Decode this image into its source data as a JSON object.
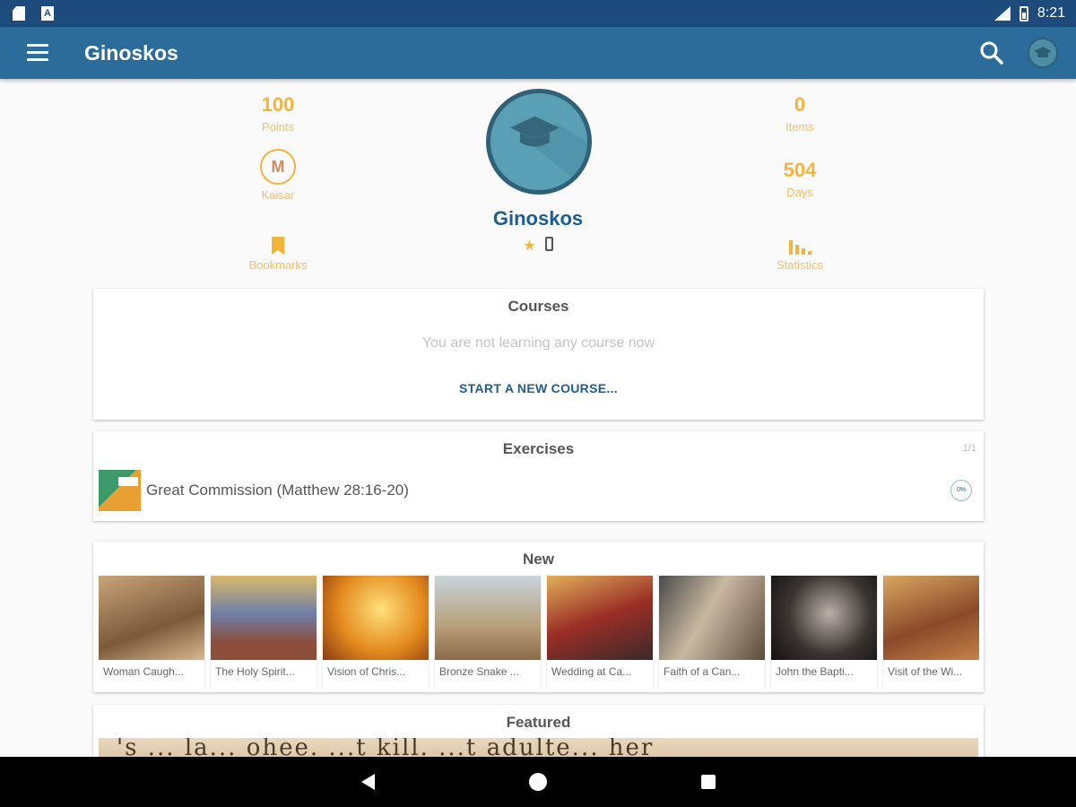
{
  "status_bar": {
    "time": "8:21"
  },
  "app_bar": {
    "title": "Ginoskos"
  },
  "profile": {
    "name": "Ginoskos",
    "points": {
      "value": "100",
      "label": "Points"
    },
    "items": {
      "value": "0",
      "label": "Items"
    },
    "days": {
      "value": "504",
      "label": "Days"
    },
    "level": {
      "label": "Kaisar"
    },
    "bookmarks": {
      "label": "Bookmarks"
    },
    "statistics": {
      "label": "Statistics"
    }
  },
  "courses": {
    "title": "Courses",
    "empty_text": "You are not learning any course now",
    "start_label": "START A NEW COURSE..."
  },
  "exercises": {
    "title": "Exercises",
    "page": "1/1",
    "items": [
      {
        "title": "Great Commission (Matthew 28:16-20)",
        "progress": "0%"
      }
    ]
  },
  "new_section": {
    "title": "New",
    "items": [
      {
        "caption": "Woman Caugh..."
      },
      {
        "caption": "The Holy Spirit..."
      },
      {
        "caption": "Vision of Chris..."
      },
      {
        "caption": "Bronze Snake ..."
      },
      {
        "caption": "Wedding at Ca..."
      },
      {
        "caption": "Faith of a Can..."
      },
      {
        "caption": "John the Bapti..."
      },
      {
        "caption": "Visit of the Wi..."
      }
    ]
  },
  "featured": {
    "title": "Featured",
    "banner_text": "'s ... la... ohee. ...t kill. ...t adulte... her"
  },
  "colors": {
    "primary": "#2b6c9b",
    "status_bar": "#1d4b7c",
    "accent": "#f4b43a",
    "name_blue": "#1f5d8f"
  }
}
